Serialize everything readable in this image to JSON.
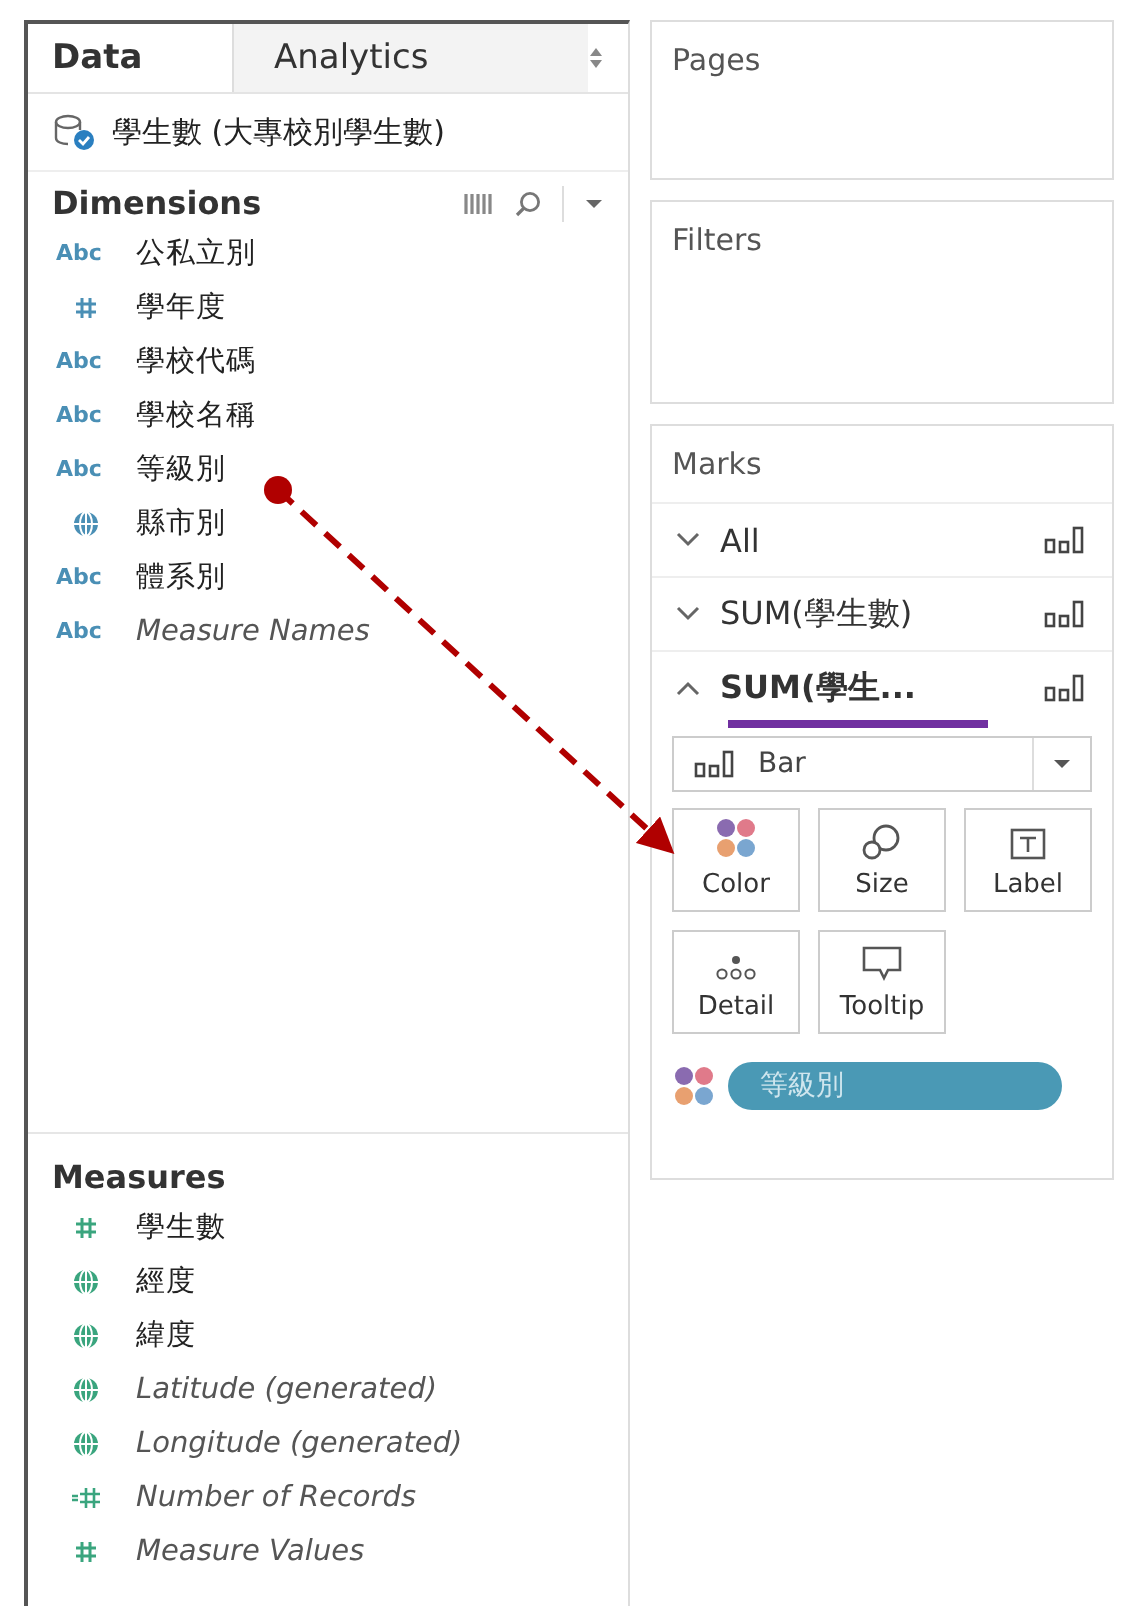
{
  "tabs": [
    {
      "label": "Data",
      "selected": true
    },
    {
      "label": "Analytics",
      "selected": false
    }
  ],
  "datasource": {
    "name": "學生數 (大專校別學生數)"
  },
  "dimensions": {
    "title": "Dimensions",
    "items": [
      {
        "kind": "text",
        "type_label": "Abc",
        "name": "公私立別",
        "generated": false
      },
      {
        "kind": "number",
        "name": "學年度",
        "generated": false
      },
      {
        "kind": "text",
        "type_label": "Abc",
        "name": "學校代碼",
        "generated": false
      },
      {
        "kind": "text",
        "type_label": "Abc",
        "name": "學校名稱",
        "generated": false
      },
      {
        "kind": "text",
        "type_label": "Abc",
        "name": "等級別",
        "generated": false
      },
      {
        "kind": "geo",
        "name": "縣市別",
        "generated": false
      },
      {
        "kind": "text",
        "type_label": "Abc",
        "name": "體系別",
        "generated": false
      },
      {
        "kind": "text",
        "type_label": "Abc",
        "name": "Measure Names",
        "generated": true
      }
    ]
  },
  "measures": {
    "title": "Measures",
    "items": [
      {
        "kind": "number",
        "name": "學生數",
        "generated": false
      },
      {
        "kind": "geo",
        "name": "經度",
        "generated": false
      },
      {
        "kind": "geo",
        "name": "緯度",
        "generated": false
      },
      {
        "kind": "geo",
        "name": "Latitude (generated)",
        "generated": true
      },
      {
        "kind": "geo",
        "name": "Longitude (generated)",
        "generated": true
      },
      {
        "kind": "count",
        "name": "Number of Records",
        "generated": true
      },
      {
        "kind": "number",
        "name": "Measure Values",
        "generated": true
      }
    ]
  },
  "pages": {
    "title": "Pages"
  },
  "filters": {
    "title": "Filters"
  },
  "marks": {
    "title": "Marks",
    "rows": [
      {
        "label": "All",
        "expanded": false,
        "underlined": false
      },
      {
        "label": "SUM(學生數)",
        "expanded": false,
        "underlined": false
      },
      {
        "label": "SUM(學生...",
        "expanded": true,
        "underlined": true
      }
    ],
    "mark_type": "Bar",
    "cards": [
      {
        "kind": "color",
        "label": "Color"
      },
      {
        "kind": "size",
        "label": "Size"
      },
      {
        "kind": "label",
        "label": "Label"
      },
      {
        "kind": "detail",
        "label": "Detail"
      },
      {
        "kind": "tooltip",
        "label": "Tooltip"
      }
    ],
    "pills": [
      {
        "kind": "color",
        "label": "等級別"
      }
    ]
  },
  "drag_arrow": {
    "shown": true
  }
}
